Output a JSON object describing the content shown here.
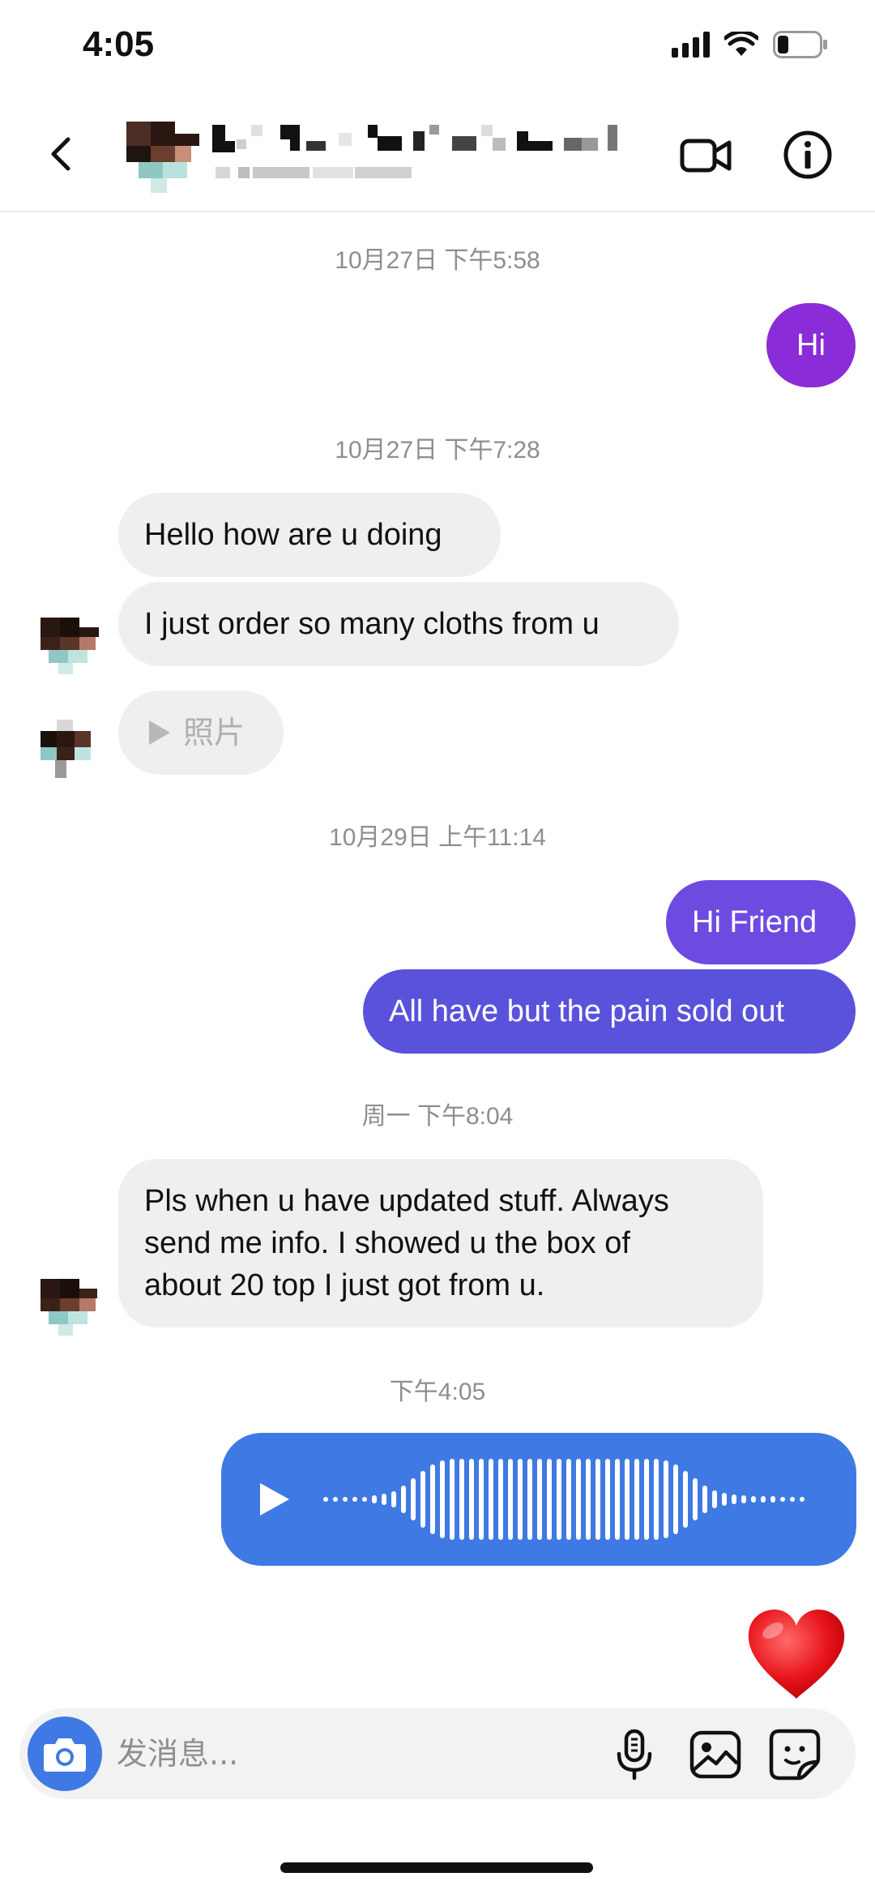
{
  "status_bar": {
    "time": "4:05",
    "battery_level": 0.25
  },
  "header": {
    "contact_name": "",
    "contact_subtitle": ""
  },
  "messages": [
    {
      "kind": "timestamp",
      "text": "10月27日 下午5:58"
    },
    {
      "kind": "outgoing",
      "text": "Hi"
    },
    {
      "kind": "timestamp",
      "text": "10月27日 下午7:28"
    },
    {
      "kind": "incoming",
      "text": "Hello how are u doing"
    },
    {
      "kind": "incoming",
      "text": "I just order so many cloths from u"
    },
    {
      "kind": "incoming-media",
      "text": "照片"
    },
    {
      "kind": "timestamp",
      "text": "10月29日 上午11:14"
    },
    {
      "kind": "outgoing",
      "text": "Hi Friend"
    },
    {
      "kind": "outgoing",
      "text": "All have but the pain sold out"
    },
    {
      "kind": "timestamp",
      "text": "周一 下午8:04"
    },
    {
      "kind": "incoming",
      "lines": [
        "Pls when u have updated stuff. Always",
        "send me info. I showed u the box of",
        "about 20 top I just got from u."
      ]
    },
    {
      "kind": "timestamp",
      "text": "下午4:05"
    },
    {
      "kind": "outgoing-voice"
    },
    {
      "kind": "outgoing-reaction",
      "emoji": "heart"
    }
  ],
  "composer": {
    "placeholder": "发消息..."
  },
  "colors": {
    "incoming_bubble": "#efefef",
    "outgoing_purple": "#8a2cd8",
    "outgoing_violet": "#6d4be0",
    "outgoing_indigo": "#5b52db",
    "voice_bubble": "#3f79e3",
    "camera_button": "#3f79e3"
  }
}
